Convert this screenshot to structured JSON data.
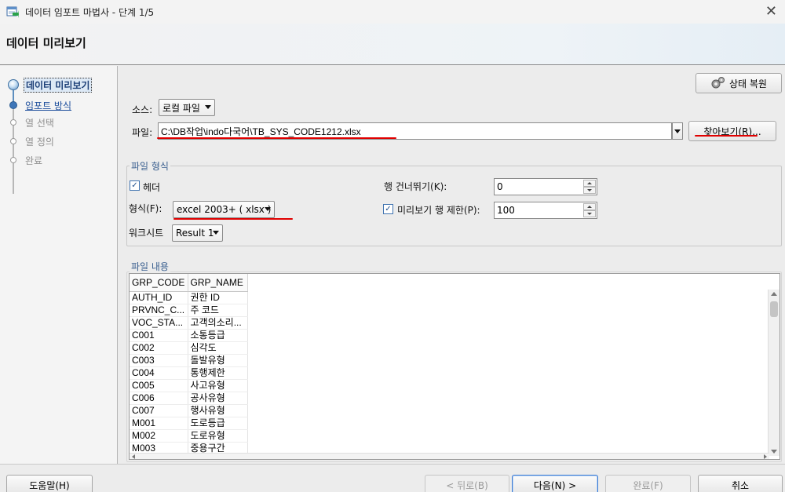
{
  "window": {
    "title": "데이터 임포트 마법사 - 단계 1/5",
    "close_glyph": "✕"
  },
  "header": {
    "step_title": "데이터 미리보기"
  },
  "sidebar": {
    "steps": [
      {
        "label": "데이터 미리보기",
        "state": "current"
      },
      {
        "label": "임포트 방식",
        "state": "link"
      },
      {
        "label": "열 선택",
        "state": "disabled"
      },
      {
        "label": "열 정의",
        "state": "disabled"
      },
      {
        "label": "완료",
        "state": "disabled"
      }
    ]
  },
  "toolbar": {
    "restore_state_label": "상태 복원",
    "restore_icon": "gears-icon"
  },
  "source": {
    "label": "소스:",
    "value": "로컬 파일"
  },
  "file": {
    "label": "파일:",
    "path": "C:\\DB작업\\indo다국어\\TB_SYS_CODE1212.xlsx",
    "browse_label": "찾아보기(R)..."
  },
  "file_format": {
    "group_title": "파일 형식",
    "header_label": "헤더",
    "header_checked": true,
    "format_label": "형식(F):",
    "format_value": "excel 2003+ ( xlsx )",
    "worksheet_label": "워크시트",
    "worksheet_value": "Result 1",
    "skip_rows_label": "행 건너뛰기(K):",
    "skip_rows_value": "0",
    "preview_limit_label": "미리보기 행 제한(P):",
    "preview_limit_checked": true,
    "preview_limit_value": "100"
  },
  "file_contents": {
    "group_title": "파일 내용",
    "columns": [
      "GRP_CODE",
      "GRP_NAME"
    ],
    "rows": [
      [
        "AUTH_ID",
        "권한 ID"
      ],
      [
        "PRVNC_C...",
        "주 코드"
      ],
      [
        "VOC_STA...",
        "고객의소리..."
      ],
      [
        "C001",
        "소통등급"
      ],
      [
        "C002",
        "심각도"
      ],
      [
        "C003",
        "돌발유형"
      ],
      [
        "C004",
        "통행제한"
      ],
      [
        "C005",
        "사고유형"
      ],
      [
        "C006",
        "공사유형"
      ],
      [
        "C007",
        "행사유형"
      ],
      [
        "M001",
        "도로등급"
      ],
      [
        "M002",
        "도로유형"
      ],
      [
        "M003",
        "중용구간"
      ]
    ]
  },
  "footer": {
    "help_label": "도움말(H)",
    "back_label": "< 뒤로(B)",
    "next_label": "다음(N) >",
    "finish_label": "완료(F)",
    "cancel_label": "취소"
  },
  "colors": {
    "annotation_red": "#e00000",
    "accent_blue": "#3d7bd4"
  }
}
